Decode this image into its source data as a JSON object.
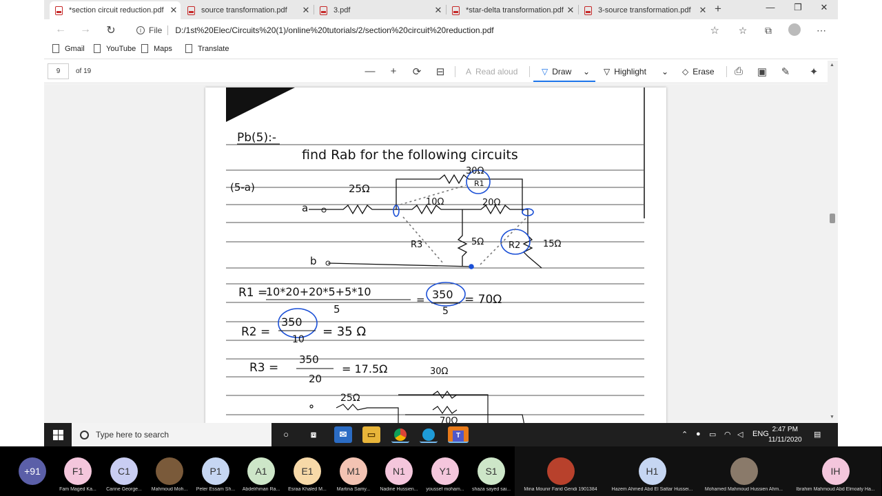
{
  "tabs": [
    {
      "label": "*section circuit reduction.pdf",
      "active": true
    },
    {
      "label": "source transformation.pdf"
    },
    {
      "label": "3.pdf"
    },
    {
      "label": "*star-delta transformation.pdf"
    },
    {
      "label": "3-source transformation.pdf"
    }
  ],
  "address": {
    "prefix": "File",
    "url": "D:/1st%20Elec/Circuits%20(1)/online%20tutorials/2/section%20circuit%20reduction.pdf"
  },
  "bookmarks": [
    "Gmail",
    "YouTube",
    "Maps",
    "Translate"
  ],
  "pdf_toolbar": {
    "page": "9",
    "of": "of 19",
    "read_aloud": "Read aloud",
    "draw": "Draw",
    "highlight": "Highlight",
    "erase": "Erase"
  },
  "handwriting": {
    "heading": "Pb(5):-",
    "instruction": "find Rab for the following circuits",
    "part": "(5-a)",
    "r30": "30Ω",
    "r25": "25Ω",
    "r10": "10Ω",
    "r20": "20Ω",
    "r5": "5Ω",
    "r15": "15Ω",
    "node_a": "a",
    "node_b": "b",
    "R1_lbl": "R1",
    "R2_lbl": "R2",
    "R3_lbl": "R3",
    "eq1_lhs": "R1 =",
    "eq1_num": "10*20+20*5+5*10",
    "eq1_den": "5",
    "eq1_eq": "=",
    "eq1_val": "350",
    "eq1_val_den": "5",
    "eq1_res": "= 70Ω",
    "eq2_lhs": "R2 =",
    "eq2_num": "350",
    "eq2_den": "10",
    "eq2_res": "= 35 Ω",
    "eq3_lhs": "R3 =",
    "eq3_num": "350",
    "eq3_den": "20",
    "eq3_res": "= 17.5Ω",
    "bottom_r30": "30Ω",
    "bottom_r25": "25Ω",
    "bottom_r70": "70Ω"
  },
  "taskbar": {
    "search_placeholder": "Type here to search",
    "lang": "ENG",
    "time": "2:47 PM",
    "date": "11/11/2020"
  },
  "participants": [
    {
      "initials": "+91",
      "name": "",
      "color": "#5b5fa8"
    },
    {
      "initials": "F1",
      "name": "Fam Maged Ka...",
      "color": "#f4c6dc"
    },
    {
      "initials": "C1",
      "name": "Carine George...",
      "color": "#c9cdf2"
    },
    {
      "initials": "",
      "name": "Mahmoud Moh...",
      "color": "#7a5a3a"
    },
    {
      "initials": "P1",
      "name": "Peter Essam Sh...",
      "color": "#c6d6f2"
    },
    {
      "initials": "A1",
      "name": "Abdelrhman Ra...",
      "color": "#cde6c8"
    },
    {
      "initials": "E1",
      "name": "Esraa Khaled M...",
      "color": "#f7d9a8"
    },
    {
      "initials": "M1",
      "name": "Martina Samy...",
      "color": "#f3c3b3"
    },
    {
      "initials": "N1",
      "name": "Nadine Hussien...",
      "color": "#f4c6dc"
    },
    {
      "initials": "Y1",
      "name": "youssef moham...",
      "color": "#f4c6dc"
    },
    {
      "initials": "S1",
      "name": "shaza sayed sai...",
      "color": "#cde6c8"
    }
  ],
  "participants_wide": [
    {
      "initials": "",
      "name": "Mina Mounir Farid Gendi 1901384",
      "color": "#b8412c"
    },
    {
      "initials": "H1",
      "name": "Hazem Ahmed Abd El Sattar Hussei...",
      "color": "#c6d6f2"
    },
    {
      "initials": "",
      "name": "Mohamed Mahmoud Hussien Ahm...",
      "color": "#8a7a6a"
    },
    {
      "initials": "IH",
      "name": "Ibrahim Mahmoud Abd Elmoaty Ha...",
      "color": "#f4c6dc"
    }
  ]
}
